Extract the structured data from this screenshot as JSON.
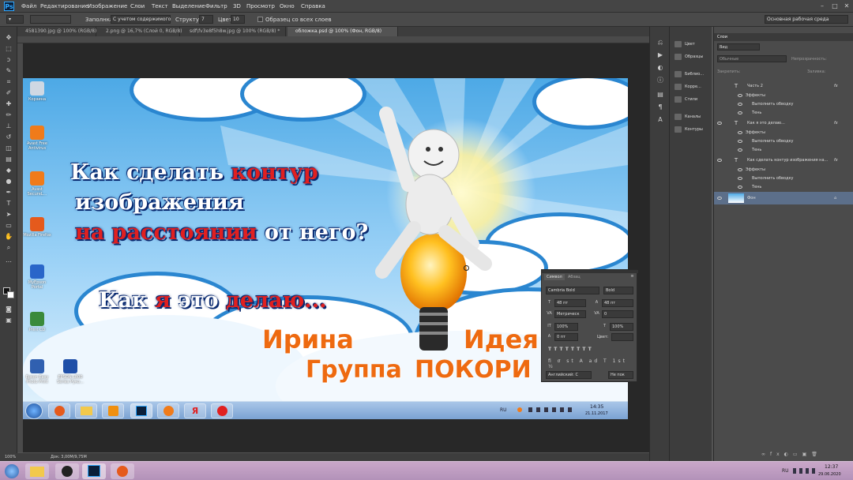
{
  "app": {
    "logo": "Ps"
  },
  "menu": [
    "Файл",
    "Редактирование",
    "Изображение",
    "Слои",
    "Текст",
    "Выделение",
    "Фильтр",
    "3D",
    "Просмотр",
    "Окно",
    "Справка"
  ],
  "options": {
    "sample_label": "Заполнка:",
    "sample_value": "С учетом содержимого",
    "structure_label": "Структура:",
    "structure_value": "7",
    "color_label": "Цвет:",
    "color_value": "10",
    "sample_all_label": "Образец со всех слоев",
    "workspace": "Основная рабочая среда"
  },
  "doc_tabs": [
    "4581390.jpg @ 100% (RGB/8)",
    "2.png @ 16,7% (Слой 0, RGB/8)",
    "sdf\\fv3e8f5h8w.jpg @ 100% (RGB/8) *",
    "обложка.psd @ 100% (Фон, RGB/8)"
  ],
  "image": {
    "desktop_icons": [
      {
        "label": "Корзина",
        "color": "#cfd8e3"
      },
      {
        "label": "Avast Free Antivirus",
        "color": "#f07b1a"
      },
      {
        "label": "Avast SecureL...",
        "color": "#f07b1a"
      },
      {
        "label": "Mozilla Firefox",
        "color": "#e55a1c"
      },
      {
        "label": "MyEpson Portal",
        "color": "#2a66c9"
      },
      {
        "label": "Print CD",
        "color": "#3a8a3a"
      },
      {
        "label": "Epson Easy Photo Print",
        "color": "#3060b0"
      },
      {
        "label": "EPSON L800 Series Руко...",
        "color": "#1e4fa8"
      }
    ],
    "headline": {
      "line1_white": "Как сделать ",
      "line1_red": "контур",
      "line2_white": "изображения",
      "line3_red": "на расстоянии",
      "line3_white": " от него?",
      "line4_white_a": "Как ",
      "line4_red": "я",
      "line4_white_b": " это ",
      "line4_red2": "делаю..."
    },
    "orange": {
      "name": "Ирина",
      "idea": "Идея",
      "group": "Группа",
      "pokori": "ПОКОРИ ИД"
    },
    "taskbar": {
      "lang": "RU",
      "time": "14:35",
      "date": "21.11.2017"
    }
  },
  "char_panel": {
    "tab_symbol": "Символ",
    "tab_para": "Абзац",
    "font": "Cambria Bold",
    "style": "Bold",
    "size": "48 пт",
    "leading": "48 пт",
    "kerning": "Метрическ",
    "tracking": "0",
    "vscale": "100%",
    "hscale": "100%",
    "baseline": "0 пт",
    "color_label": "Цвет:",
    "lang": "Английский: С",
    "aa": "Не пок"
  },
  "status": {
    "zoom": "100%",
    "doc": "Док: 3,00M/9,75M"
  },
  "panel_col": [
    {
      "label": "Цвет"
    },
    {
      "label": "Образцы"
    },
    {
      "label": "Библио..."
    },
    {
      "label": "Корре..."
    },
    {
      "label": "Стили"
    },
    {
      "label": "Каналы"
    },
    {
      "label": "Контуры"
    }
  ],
  "layers": {
    "tab": "Слои",
    "filter": "Вид",
    "blend": "Обычные",
    "opacity_label": "Непрозрачность:",
    "lock_label": "Закрепить:",
    "fill_label": "Заливка:",
    "rows": [
      {
        "name": "Часть 2",
        "type": "T"
      },
      {
        "name": "Эффекты",
        "type": "fx-head"
      },
      {
        "name": "Выполнить обводку",
        "type": "fx"
      },
      {
        "name": "Тень",
        "type": "fx"
      },
      {
        "name": "Как я это делаю...",
        "type": "T"
      },
      {
        "name": "Эффекты",
        "type": "fx-head"
      },
      {
        "name": "Выполнить обводку",
        "type": "fx"
      },
      {
        "name": "Тень",
        "type": "fx"
      },
      {
        "name": "Как сделать контур   изображения  на...",
        "type": "T"
      },
      {
        "name": "Эффекты",
        "type": "fx-head"
      },
      {
        "name": "Выполнить обводку",
        "type": "fx"
      },
      {
        "name": "Тень",
        "type": "fx"
      },
      {
        "name": "Фон",
        "type": "bg"
      }
    ]
  },
  "win_taskbar": {
    "lang": "RU",
    "time": "12:37",
    "date": "29.06.2020"
  }
}
